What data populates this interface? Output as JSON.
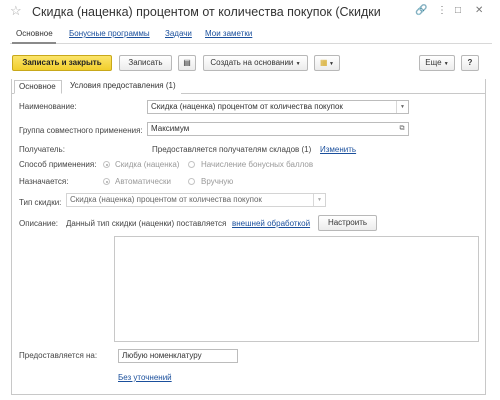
{
  "window": {
    "title": "Скидка (наценка) процентом от количества покупок (Скидки (нац…",
    "star_icon": "star-icon",
    "link_icon": "link-icon",
    "more_icon": "more-icon",
    "minimize_icon": "minimize-icon",
    "close_icon": "close-icon"
  },
  "nav": {
    "tabs": [
      "Основное",
      "Бонусные программы",
      "Задачи",
      "Мои заметки"
    ]
  },
  "toolbar": {
    "save_close": "Записать и закрыть",
    "save": "Записать",
    "create_based": "Создать на основании",
    "more": "Еще",
    "help": "?"
  },
  "form_tabs": [
    "Основное",
    "Условия предоставления (1)"
  ],
  "form": {
    "name_label": "Наименование:",
    "name_value": "Скидка (наценка) процентом от количества покупок",
    "group_label": "Группа совместного применения:",
    "group_value": "Максимум",
    "recipient_label": "Получатель:",
    "recipient_text": "Предоставляется получателям складов (1)",
    "recipient_link": "Изменить",
    "method_label": "Способ применения:",
    "method_opt1": "Скидка (наценка)",
    "method_opt2": "Начисление бонусных баллов",
    "assign_label": "Назначается:",
    "assign_opt1": "Автоматически",
    "assign_opt2": "Вручную",
    "type_label": "Тип скидки:",
    "type_value": "Скидка (наценка) процентом от количества покупок",
    "desc_label": "Описание:",
    "desc_text": "Данный тип скидки (наценки) поставляется",
    "desc_link": "внешней обработкой",
    "configure": "Настроить",
    "provided_label": "Предоставляется на:",
    "provided_value": "Любую номенклатуру",
    "no_refine": "Без уточнений"
  },
  "colors": {
    "accent": "#f1ce2c",
    "link": "#1a4f9c"
  }
}
